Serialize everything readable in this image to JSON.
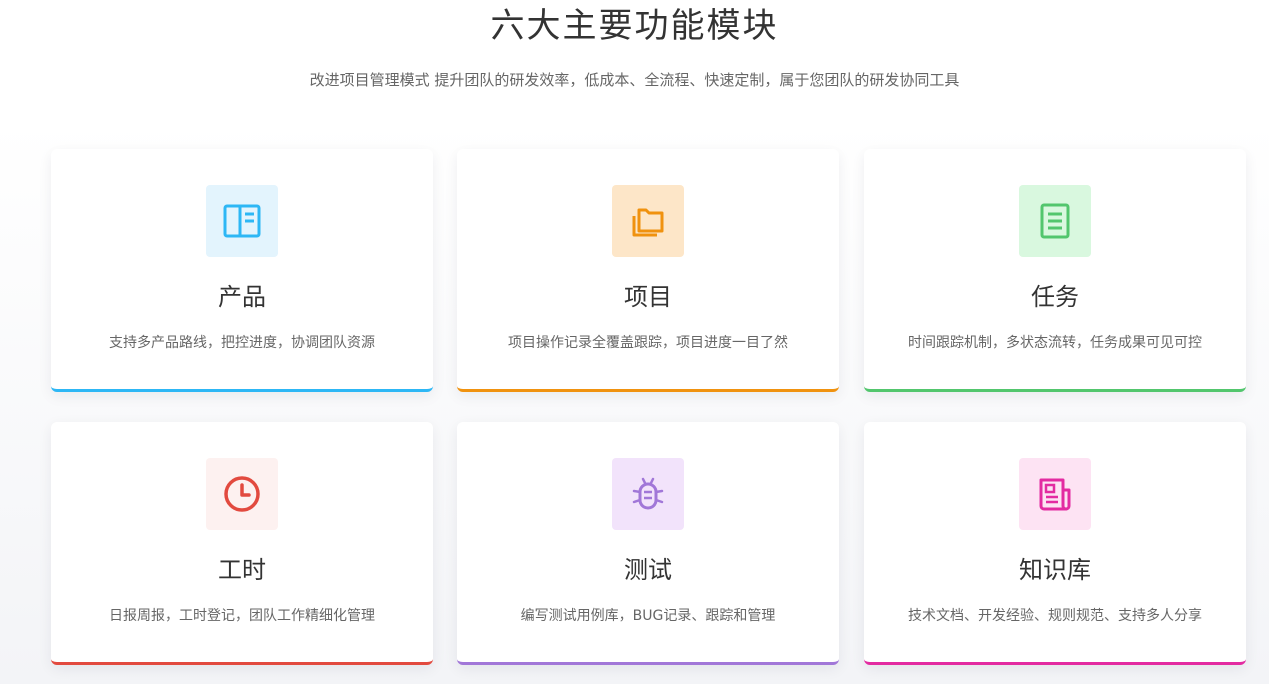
{
  "section": {
    "title": "六大主要功能模块",
    "subtitle": "改进项目管理模式 提升团队的研发效率，低成本、全流程、快速定制，属于您团队的研发协同工具"
  },
  "modules": [
    {
      "title": "产品",
      "desc": "支持多产品路线，把控进度，协调团队资源",
      "icon": "product-layout-icon",
      "accent": "#2db7f5",
      "icon_bg": "#e3f4fd"
    },
    {
      "title": "项目",
      "desc": "项目操作记录全覆盖跟踪，项目进度一目了然",
      "icon": "folders-icon",
      "accent": "#f0920f",
      "icon_bg": "#fde6c8"
    },
    {
      "title": "任务",
      "desc": "时间跟踪机制，多状态流转，任务成果可见可控",
      "icon": "document-list-icon",
      "accent": "#52c66d",
      "icon_bg": "#d9f8df"
    },
    {
      "title": "工时",
      "desc": "日报周报，工时登记，团队工作精细化管理",
      "icon": "clock-icon",
      "accent": "#e24a3f",
      "icon_bg": "#fdf1f0"
    },
    {
      "title": "测试",
      "desc": "编写测试用例库，BUG记录、跟踪和管理",
      "icon": "bug-icon",
      "accent": "#a177d8",
      "icon_bg": "#f2e3fb"
    },
    {
      "title": "知识库",
      "desc": "技术文档、开发经验、规则规范、支持多人分享",
      "icon": "newspaper-icon",
      "accent": "#e32ba1",
      "icon_bg": "#fde3f3"
    }
  ]
}
